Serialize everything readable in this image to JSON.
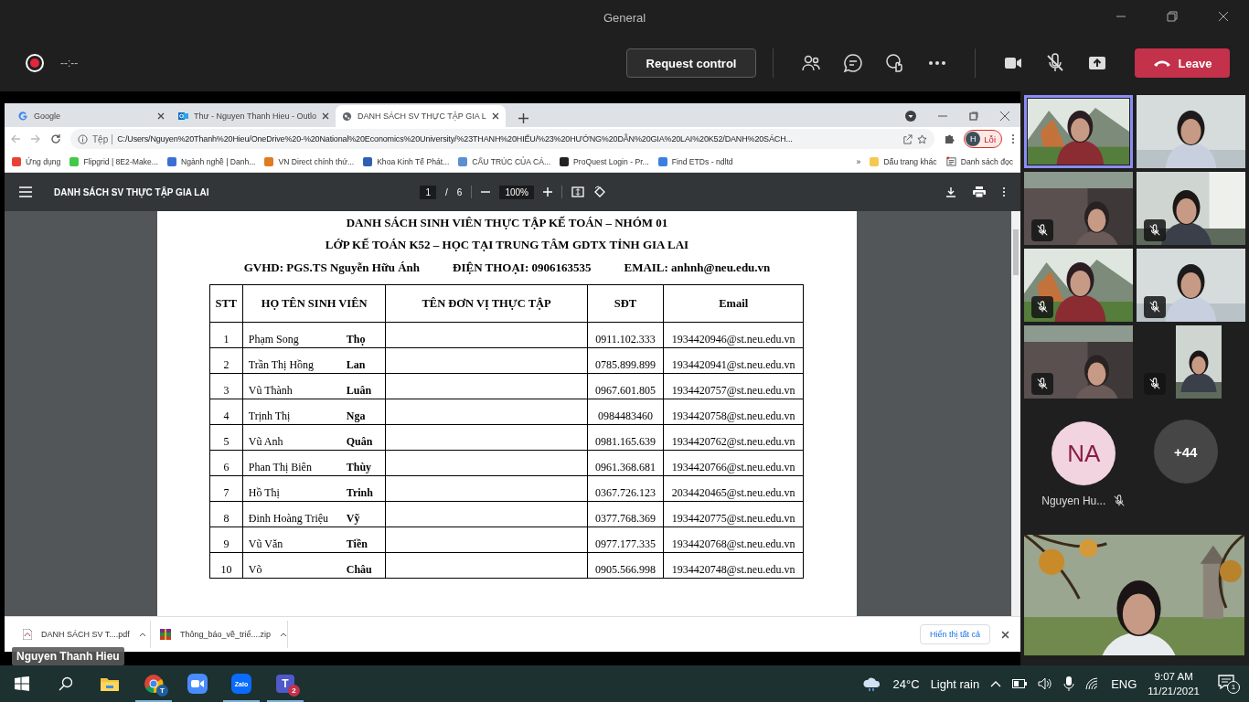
{
  "window": {
    "title": "General"
  },
  "meeting_bar": {
    "timer": "--:--",
    "request_control": "Request control",
    "leave": "Leave",
    "camera_on": true,
    "mic_muted": true
  },
  "browser": {
    "tabs": [
      {
        "title": "Google",
        "kind": "google",
        "selected": false
      },
      {
        "title": "Thư - Nguyen Thanh Hieu - Outlo",
        "kind": "mail",
        "selected": false
      },
      {
        "title": "DANH SÁCH SV THỰC TẬP GIA L",
        "kind": "globe",
        "selected": true
      }
    ],
    "address": {
      "scheme": "Tệp",
      "url": "C:/Users/Nguyen%20Thanh%20Hieu/OneDrive%20-%20National%20Economics%20University/%23THANH%20HIẾU/%23%20HƯỚNG%20DẪN%20GIA%20LAI%20K52/DANH%20SÁCH..."
    },
    "profile": {
      "initial": "H",
      "label": "Lỗi"
    },
    "bookmarks": [
      {
        "label": "Ứng dụng",
        "color": "#e94235"
      },
      {
        "label": "Flipgrid | 8E2-Make...",
        "color": "#43c94a"
      },
      {
        "label": "Ngành nghề | Danh...",
        "color": "#3b6fd4"
      },
      {
        "label": "VN Direct chính thứ...",
        "color": "#e07b20"
      },
      {
        "label": "Khoa Kinh Tế Phát...",
        "color": "#2f5fb3"
      },
      {
        "label": "CẤU TRÚC CỦA CÁ...",
        "color": "#5b8fd0"
      },
      {
        "label": "ProQuest Login - Pr...",
        "color": "#222222"
      },
      {
        "label": "Find ETDs - ndltd",
        "color": "#3d7fe0"
      }
    ],
    "bookmarks_more": "»",
    "other_bookmarks": "Dấu trang khác",
    "reading_list": "Danh sách đọc"
  },
  "pdf_viewer": {
    "title": "DANH SÁCH SV THỰC TẬP GIA LAI",
    "page": "1",
    "separator": "/",
    "page_count": "6",
    "zoom": "100%"
  },
  "document": {
    "title_lines": [
      "DANH SÁCH SINH VIÊN THỰC TẬP KẾ TOÁN – NHÓM 01",
      "LỚP KẾ TOÁN K52 – HỌC TẠI TRUNG TÂM GDTX TỈNH GIA LAI"
    ],
    "info": [
      "GVHD: PGS.TS Nguyễn Hữu Ánh",
      "ĐIỆN THOẠI: 0906163535",
      "EMAIL: anhnh@neu.edu.vn"
    ],
    "table": {
      "columns": [
        "STT",
        "HỌ TÊN SINH VIÊN",
        "TÊN ĐƠN VỊ THỰC TẬP",
        "SĐT",
        "Email"
      ],
      "rows": [
        {
          "stt": "1",
          "surname": "Phạm Song",
          "given_name": "Thọ",
          "phone": "0911.102.333",
          "email": "1934420946@st.neu.edu.vn"
        },
        {
          "stt": "2",
          "surname": "Trần Thị Hồng",
          "given_name": "Lan",
          "phone": "0785.899.899",
          "email": "1934420941@st.neu.edu.vn"
        },
        {
          "stt": "3",
          "surname": "Vũ Thành",
          "given_name": "Luân",
          "phone": "0967.601.805",
          "email": "1934420757@st.neu.edu.vn"
        },
        {
          "stt": "4",
          "surname": "Trịnh Thị",
          "given_name": "Nga",
          "phone": "0984483460",
          "email": "1934420758@st.neu.edu.vn"
        },
        {
          "stt": "5",
          "surname": "Vũ Anh",
          "given_name": "Quân",
          "phone": "0981.165.639",
          "email": "1934420762@st.neu.edu.vn"
        },
        {
          "stt": "6",
          "surname": "Phan Thị Biên",
          "given_name": "Thùy",
          "phone": "0961.368.681",
          "email": "1934420766@st.neu.edu.vn"
        },
        {
          "stt": "7",
          "surname": "Hồ Thị",
          "given_name": "Trinh",
          "phone": "0367.726.123",
          "email": "2034420465@st.neu.edu.vn"
        },
        {
          "stt": "8",
          "surname": "Đinh Hoàng Triệu",
          "given_name": "Vỹ",
          "phone": "0377.768.369",
          "email": "1934420775@st.neu.edu.vn"
        },
        {
          "stt": "9",
          "surname": "Vũ Văn",
          "given_name": "Tiền",
          "phone": "0977.177.335",
          "email": "1934420768@st.neu.edu.vn"
        },
        {
          "stt": "10",
          "surname": "Võ",
          "given_name": "Châu",
          "phone": "0905.566.998",
          "email": "1934420748@st.neu.edu.vn"
        }
      ]
    }
  },
  "downloads": {
    "items": [
      {
        "name": "DANH SÁCH SV T....pdf",
        "kind": "pdf"
      },
      {
        "name": "Thông_báo_về_triể....zip",
        "kind": "zip"
      }
    ],
    "show_all": "Hiển thị tất cả"
  },
  "presenter_label": "Nguyen Thanh Hieu",
  "gallery": {
    "tiles": [
      {
        "kind": "video",
        "selected": true,
        "muted": false
      },
      {
        "kind": "video",
        "selected": false,
        "muted": false
      },
      {
        "kind": "video",
        "selected": false,
        "muted": true
      },
      {
        "kind": "video",
        "selected": false,
        "muted": true
      },
      {
        "kind": "video",
        "selected": false,
        "muted": true
      },
      {
        "kind": "video",
        "selected": false,
        "muted": true
      },
      {
        "kind": "video",
        "selected": false,
        "muted": true
      },
      {
        "kind": "portrait",
        "selected": false,
        "muted": true
      }
    ],
    "avatar": {
      "initials": "NA",
      "name": "Nguyen Hu...",
      "muted": true
    },
    "overflow": "+44"
  },
  "taskbar": {
    "apps": [
      {
        "kind": "explorer",
        "running": false
      },
      {
        "kind": "chrome",
        "running": true,
        "badge": "T"
      },
      {
        "kind": "zoom",
        "running": false
      },
      {
        "kind": "zalo",
        "running": true,
        "logo_text": "Zalo"
      },
      {
        "kind": "teams",
        "running": true,
        "logo_text": "T",
        "badge": "2"
      }
    ],
    "tray": {
      "temperature": "24°C",
      "weather": "Light rain",
      "language": "ENG",
      "time": "9:07 AM",
      "date": "11/21/2021",
      "notifications": "1"
    }
  }
}
